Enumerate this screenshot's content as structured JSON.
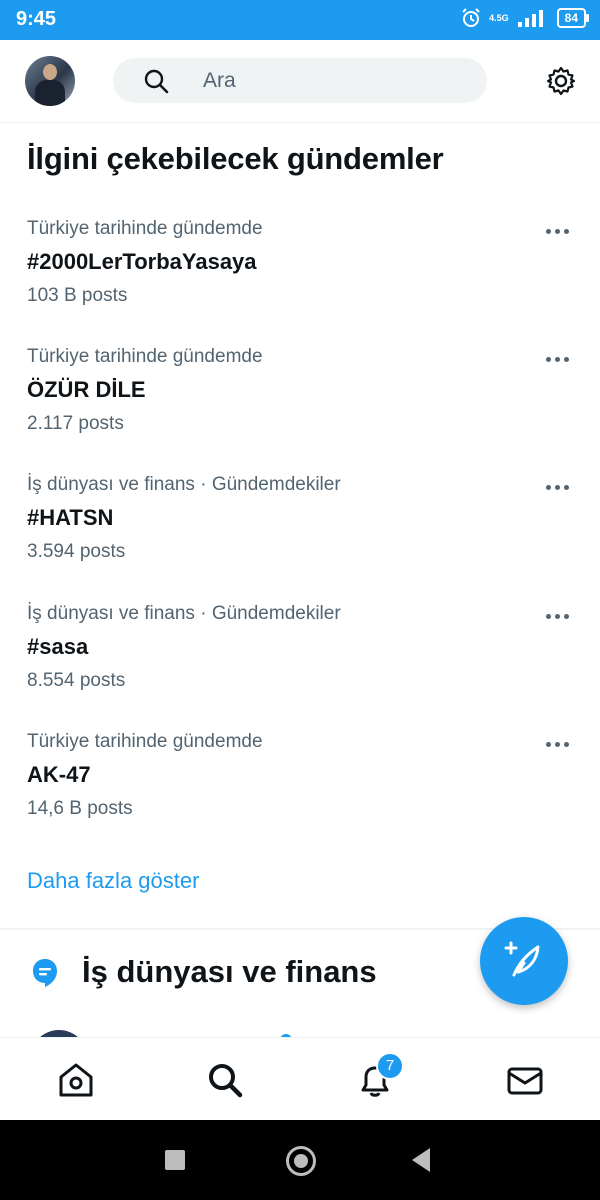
{
  "status": {
    "time": "9:45",
    "network": "4.5G",
    "battery": "84"
  },
  "search": {
    "placeholder": "Ara"
  },
  "explore": {
    "heading": "İlgini çekebilecek gündemler",
    "trends": [
      {
        "category": "Türkiye tarihinde gündemde",
        "name": "#2000LerTorbaYasaya",
        "count": "103 B posts"
      },
      {
        "category": "Türkiye tarihinde gündemde",
        "name": "ÖZÜR DİLE",
        "count": "2.117 posts"
      },
      {
        "category": "İş dünyası ve finans · Gündemdekiler",
        "name": "#HATSN",
        "count": "3.594 posts"
      },
      {
        "category": "İş dünyası ve finans · Gündemdekiler",
        "name": "#sasa",
        "count": "8.554 posts"
      },
      {
        "category": "Türkiye tarihinde gündemde",
        "name": "AK-47",
        "count": "14,6 B posts"
      }
    ],
    "show_more": "Daha fazla göster",
    "section_title": "İş dünyası ve finans"
  },
  "tabs": [
    {
      "name": "home",
      "icon": "home-icon"
    },
    {
      "name": "search",
      "icon": "search-icon"
    },
    {
      "name": "notifications",
      "icon": "bell-icon",
      "badge": "7"
    },
    {
      "name": "messages",
      "icon": "mail-icon"
    }
  ],
  "colors": {
    "accent": "#1d9bf0",
    "text_secondary": "#536471"
  }
}
